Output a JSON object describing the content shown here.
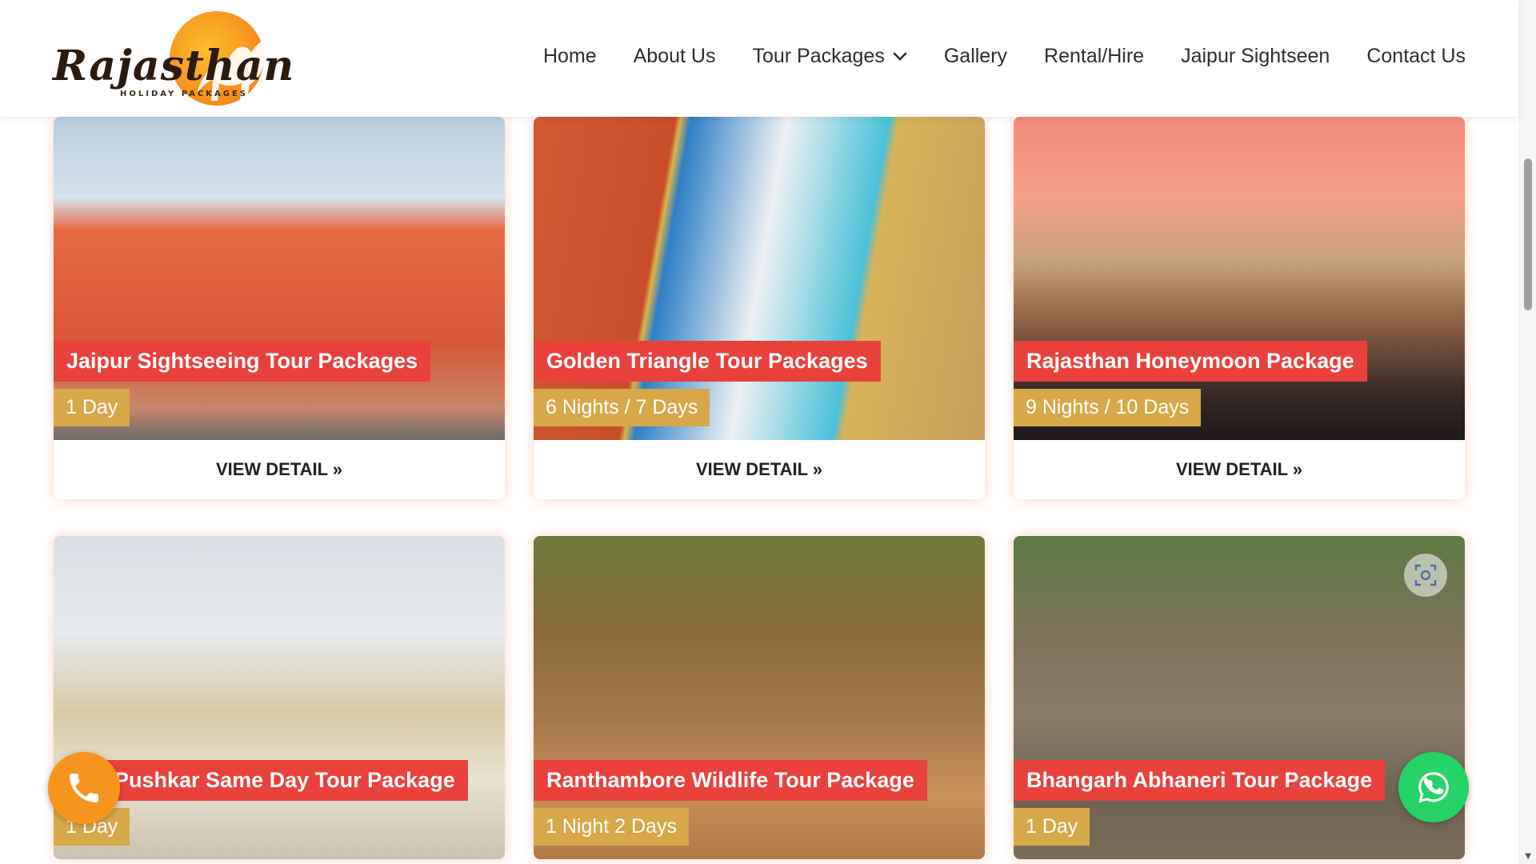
{
  "brand": {
    "name": "Rajasthan",
    "tagline": "HOLIDAY PACKAGES",
    "colors": {
      "orange": "#f7941d",
      "red": "#e8413c",
      "gold": "#d6a84a",
      "green": "#25d366"
    }
  },
  "nav": {
    "items": [
      {
        "label": "Home"
      },
      {
        "label": "About Us"
      },
      {
        "label": "Tour Packages",
        "icon": "chevron-down-icon"
      },
      {
        "label": "Gallery"
      },
      {
        "label": "Rental/Hire"
      },
      {
        "label": "Jaipur Sightseen"
      },
      {
        "label": "Contact Us"
      }
    ]
  },
  "packages": [
    {
      "title": "Jaipur Sightseeing Tour Packages",
      "duration": "1 Day",
      "cta": "VIEW DETAIL »"
    },
    {
      "title": "Golden Triangle Tour Packages",
      "duration": "6 Nights / 7 Days",
      "cta": "VIEW DETAIL »"
    },
    {
      "title": "Rajasthan Honeymoon Package",
      "duration": "9 Nights / 10 Days",
      "cta": "VIEW DETAIL »"
    },
    {
      "title": "r Pushkar Same Day Tour Package",
      "duration": "1 Day"
    },
    {
      "title": "Ranthambore Wildlife Tour Package",
      "duration": "1 Night 2 Days"
    },
    {
      "title": "Bhangarh Abhaneri Tour Package",
      "duration": "1 Day"
    }
  ],
  "floating": {
    "call_icon": "phone-icon",
    "whatsapp_icon": "whatsapp-icon",
    "lens_icon": "visual-search-icon"
  }
}
